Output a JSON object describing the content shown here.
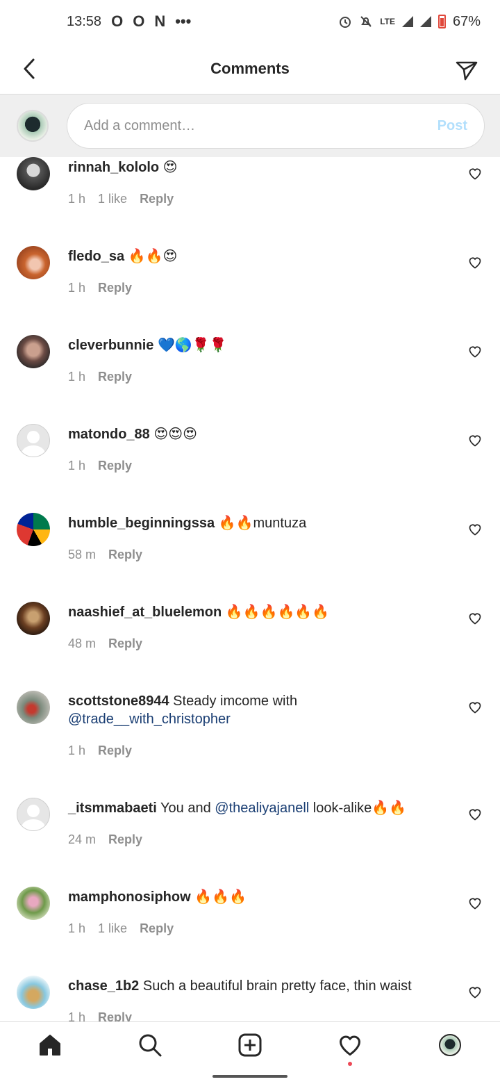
{
  "status_bar": {
    "time": "13:58",
    "left_icons": [
      "O",
      "O",
      "N",
      "•••"
    ],
    "right_icons": [
      "alarm-icon",
      "mute-icon",
      "lte-icon",
      "signal-icon",
      "signal-icon",
      "battery-icon"
    ],
    "lte": "LTE",
    "battery_percent": "67%"
  },
  "header": {
    "title": "Comments"
  },
  "add_comment": {
    "placeholder": "Add a comment…",
    "post_label": "Post"
  },
  "comments": [
    {
      "user": "rinnah_kololo",
      "text": " 😍",
      "time": "1 h",
      "likes": "1 like",
      "reply": "Reply"
    },
    {
      "user": "fledo_sa",
      "text": " 🔥🔥😍",
      "time": "1 h",
      "likes": "",
      "reply": "Reply"
    },
    {
      "user": "cleverbunnie",
      "text": " 💙🌎🌹🌹",
      "time": "1 h",
      "likes": "",
      "reply": "Reply"
    },
    {
      "user": "matondo_88",
      "text": " 😍😍😍",
      "time": "1 h",
      "likes": "",
      "reply": "Reply"
    },
    {
      "user": "humble_beginningssa",
      "text": " 🔥🔥muntuza",
      "time": "58 m",
      "likes": "",
      "reply": "Reply"
    },
    {
      "user": "naashief_at_bluelemon",
      "text": " 🔥🔥🔥🔥🔥🔥",
      "time": "48 m",
      "likes": "",
      "reply": "Reply"
    },
    {
      "user": "scottstone8944",
      "text": " Steady imcome with ",
      "mention": "@trade__with_christopher",
      "time": "1 h",
      "likes": "",
      "reply": "Reply"
    },
    {
      "user": "_itsmmabaeti",
      "text": " You and ",
      "mention": "@thealiyajanell",
      "text_after": " look-alike🔥🔥",
      "time": "24 m",
      "likes": "",
      "reply": "Reply"
    },
    {
      "user": "mamphonosiphow",
      "text": " 🔥🔥🔥",
      "time": "1 h",
      "likes": "1 like",
      "reply": "Reply"
    },
    {
      "user": "chase_1b2",
      "text": " Such a beautiful brain pretty face, thin waist",
      "time": "1 h",
      "likes": "",
      "reply": "Reply"
    }
  ],
  "bottom_nav": [
    "home-icon",
    "search-icon",
    "new-post-icon",
    "activity-icon",
    "profile-avatar"
  ]
}
